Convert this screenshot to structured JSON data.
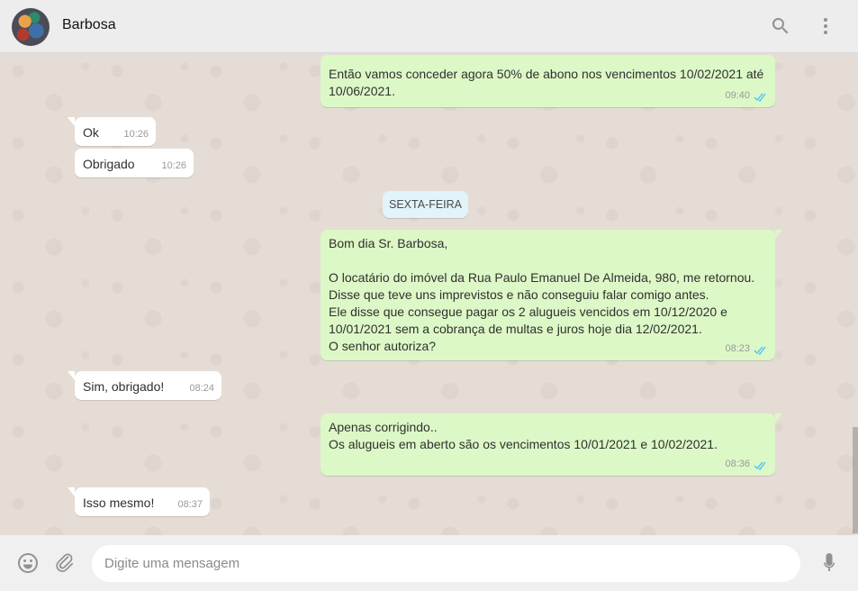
{
  "header": {
    "contact_name": "Barbosa",
    "search_icon": "search-icon",
    "menu_icon": "kebab-menu-icon"
  },
  "messages": [
    {
      "dir": "out",
      "text": "Então vamos conceder agora 50% de abono nos vencimentos 10/02/2021 até\n10/06/2021.",
      "time": "09:40",
      "read": true
    },
    {
      "dir": "in",
      "text": "Ok",
      "time": "10:26"
    },
    {
      "dir": "in",
      "text": "Obrigado",
      "time": "10:26"
    },
    {
      "dir": "out",
      "text": "Bom dia Sr. Barbosa,\n\nO locatário do imóvel da Rua Paulo Emanuel De Almeida, 980, me retornou.\nDisse que teve uns imprevistos e não conseguiu falar comigo antes.\nEle disse que consegue pagar os 2 alugueis vencidos em 10/12/2020 e\n10/01/2021 sem a cobrança de multas e juros hoje dia 12/02/2021.\nO senhor autoriza?",
      "time": "08:23",
      "read": true
    },
    {
      "dir": "in",
      "text": "Sim, obrigado!",
      "time": "08:24"
    },
    {
      "dir": "out",
      "text": "Apenas corrigindo..\nOs alugueis em aberto são os vencimentos 10/01/2021 e 10/02/2021.",
      "time": "08:36",
      "read": true
    },
    {
      "dir": "in",
      "text": "Isso mesmo!",
      "time": "08:37"
    }
  ],
  "day_divider": "SEXTA-FEIRA",
  "composer": {
    "placeholder": "Digite uma mensagem",
    "value": "",
    "emoji_icon": "emoji-icon",
    "attach_icon": "paperclip-icon",
    "mic_icon": "microphone-icon"
  },
  "colors": {
    "outgoing_bubble": "#dcf8c6",
    "incoming_bubble": "#ffffff",
    "read_ticks": "#4fc3f7",
    "chat_background": "#e5ddd5"
  }
}
